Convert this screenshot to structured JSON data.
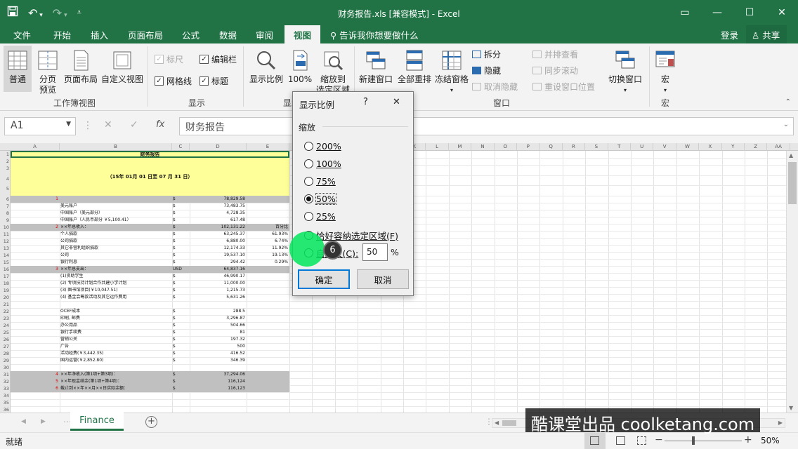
{
  "window": {
    "title": "财务报告.xls  [兼容模式] - Excel"
  },
  "tabs": [
    "文件",
    "开始",
    "插入",
    "页面布局",
    "公式",
    "数据",
    "审阅",
    "视图"
  ],
  "tell_me": "告诉我你想要做什么",
  "account": {
    "login": "登录",
    "share": "共享"
  },
  "ribbon": {
    "workbook_views": {
      "label": "工作簿视图",
      "normal": "普通",
      "page_break_1": "分页",
      "page_break_2": "预览",
      "page_layout": "页面布局",
      "custom": "自定义视图"
    },
    "show": {
      "label": "显示",
      "ruler": "标尺",
      "formula_bar": "编辑栏",
      "gridlines": "网格线",
      "headings": "标题"
    },
    "zoom": {
      "label": "显示",
      "zoom": "显示比例",
      "hundred": "100%",
      "zoom_sel_1": "缩放到",
      "zoom_sel_2": "选定区域"
    },
    "window": {
      "label": "窗口",
      "new": "新建窗口",
      "arrange": "全部重排",
      "freeze": "冻结窗格",
      "split": "拆分",
      "hide": "隐藏",
      "unhide": "取消隐藏",
      "side": "并排查看",
      "sync": "同步滚动",
      "reset": "重设窗口位置",
      "switch": "切换窗口"
    },
    "macros": {
      "label": "宏",
      "macro": "宏"
    }
  },
  "formula_bar": {
    "name_box": "A1",
    "content": "财务报告"
  },
  "columns": [
    "A",
    "B",
    "C",
    "D",
    "E",
    "F",
    "G",
    "H",
    "I",
    "J",
    "K",
    "L",
    "M",
    "N",
    "O",
    "P",
    "Q",
    "R",
    "S",
    "T",
    "U",
    "V",
    "W",
    "X",
    "Y",
    "Z",
    "AA"
  ],
  "sheet": {
    "title": "财务报告",
    "subtitle": "（15年  01月  01  日至  07  月  31  日）",
    "rows": [
      {
        "r": 6,
        "a": "1",
        "b": "",
        "c": "$",
        "d": "78,829.58",
        "e": ""
      },
      {
        "r": 7,
        "a": "",
        "b": "美元账户",
        "c": "$",
        "d": "73,483.75",
        "e": ""
      },
      {
        "r": 8,
        "a": "",
        "b": "中国账户（美元部分）",
        "c": "$",
        "d": "4,728.35",
        "e": ""
      },
      {
        "r": 9,
        "a": "",
        "b": "中国账户（人民币部分 ￥5,100.41）",
        "c": "$",
        "d": "617.48",
        "e": ""
      },
      {
        "r": 10,
        "a": "2",
        "b": "××年总收入：",
        "c": "$",
        "d": "102,131.22",
        "e": "百分比"
      },
      {
        "r": 11,
        "a": "",
        "b": "个人捐款",
        "c": "$",
        "d": "63,245.37",
        "e": "61.93%"
      },
      {
        "r": 12,
        "a": "",
        "b": "公司捐款",
        "c": "$",
        "d": "6,880.00",
        "e": "6.74%"
      },
      {
        "r": 13,
        "a": "",
        "b": "其它非营利组织捐款",
        "c": "$",
        "d": "12,174.33",
        "e": "11.92%"
      },
      {
        "r": 14,
        "a": "",
        "b": "公司",
        "c": "$",
        "d": "19,537.10",
        "e": "19.13%"
      },
      {
        "r": 15,
        "a": "",
        "b": "银行利息",
        "c": "$",
        "d": "294.42",
        "e": "0.29%"
      },
      {
        "r": 16,
        "a": "3",
        "b": "××年总支出：",
        "c": "USD",
        "d": "64,837.16",
        "e": ""
      },
      {
        "r": 17,
        "a": "",
        "b": "(1)资助学生",
        "c": "$",
        "d": "46,990.17",
        "e": ""
      },
      {
        "r": 18,
        "a": "",
        "b": "(2) 专项扶持计划合作共建小学计划",
        "c": "$",
        "d": "11,000.00",
        "e": ""
      },
      {
        "r": 19,
        "a": "",
        "b": "(3) 图书馆项目(￥10,047.51)",
        "c": "$",
        "d": "1,215.73",
        "e": ""
      },
      {
        "r": 20,
        "a": "",
        "b": "(4) 基金会筹款活动及其它运作费用",
        "c": "$",
        "d": "5,631.26",
        "e": ""
      },
      {
        "r": 22,
        "a": "",
        "b": "   OCEF成本",
        "c": "$",
        "d": "288.5",
        "e": ""
      },
      {
        "r": 23,
        "a": "",
        "b": "   印刷, 邮费",
        "c": "$",
        "d": "3,296.87",
        "e": ""
      },
      {
        "r": 24,
        "a": "",
        "b": "   办公用品",
        "c": "$",
        "d": "504.66",
        "e": ""
      },
      {
        "r": 25,
        "a": "",
        "b": "   银行手续费",
        "c": "$",
        "d": "81",
        "e": ""
      },
      {
        "r": 26,
        "a": "",
        "b": "   营销公关",
        "c": "$",
        "d": "197.32",
        "e": ""
      },
      {
        "r": 27,
        "a": "",
        "b": "   广告",
        "c": "$",
        "d": "500",
        "e": ""
      },
      {
        "r": 28,
        "a": "",
        "b": "   活动经费(￥3,442.35)",
        "c": "$",
        "d": "416.52",
        "e": ""
      },
      {
        "r": 29,
        "a": "",
        "b": "   国内运营(￥2,852.80)",
        "c": "$",
        "d": "346.39",
        "e": ""
      },
      {
        "r": 31,
        "a": "4",
        "b": "××年净收入(第1项+第3项)：",
        "c": "$",
        "d": "37,294.06",
        "e": ""
      },
      {
        "r": 32,
        "a": "5",
        "b": "××年现金结余(第1项+第4项)：",
        "c": "$",
        "d": "116,124",
        "e": ""
      },
      {
        "r": 33,
        "a": "6",
        "b": "截止到××年××月××日实际余额：",
        "c": "$",
        "d": "116,123",
        "e": ""
      }
    ]
  },
  "dialog": {
    "title": "显示比例",
    "help": "?",
    "close": "✕",
    "group_label": "缩放",
    "options": [
      "200%",
      "100%",
      "75%",
      "50%",
      "25%",
      "恰好容纳选定区域(F)",
      "自定义(C):"
    ],
    "selected": "50%",
    "custom_value": "50",
    "percent": "%",
    "ok": "确定",
    "cancel": "取消"
  },
  "step_badge": "6",
  "sheet_tab": "Finance",
  "status": {
    "ready": "就绪",
    "zoom": "50%"
  },
  "watermark": "酷课堂出品 coolketang.com"
}
